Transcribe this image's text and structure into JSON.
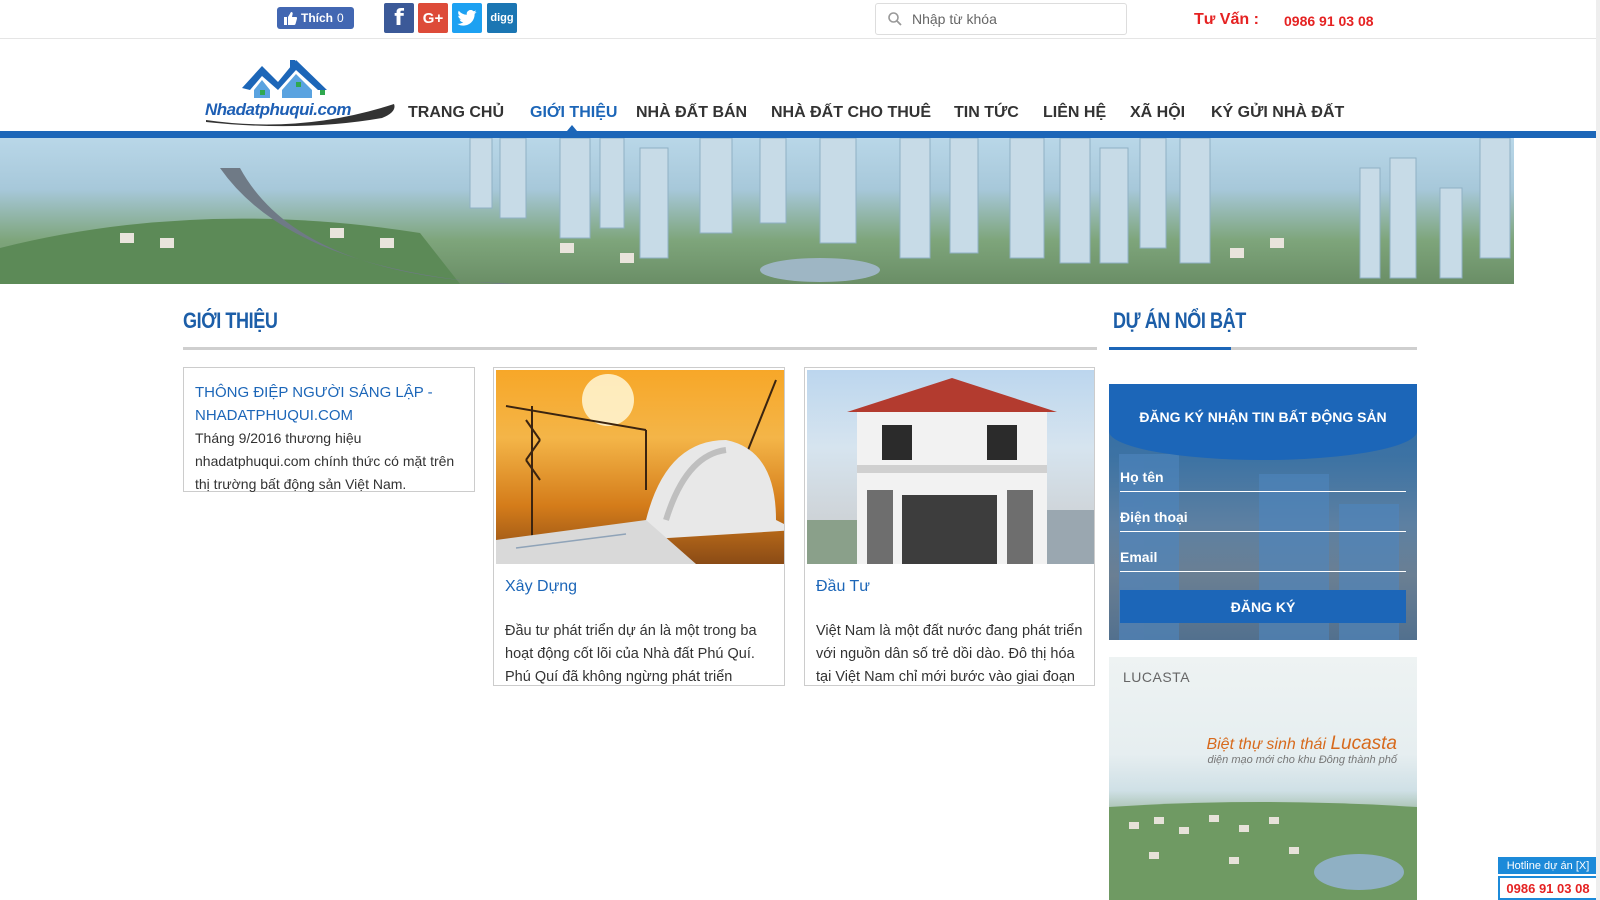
{
  "topbar": {
    "like_label": "Thích",
    "like_count": "0",
    "social": [
      "f",
      "G+",
      "digg"
    ],
    "search_placeholder": "Nhập từ khóa",
    "consult_label": "Tư Vấn :",
    "consult_phone": "0986 91 03 08"
  },
  "header": {
    "logo_text": "Nhadatphuqui.com",
    "nav": [
      "TRANG CHỦ",
      "GIỚI THIỆU",
      "NHÀ ĐẤT BÁN",
      "NHÀ ĐẤT CHO THUÊ",
      "TIN TỨC",
      "LIÊN HỆ",
      "XÃ HỘI",
      "KÝ GỬI NHÀ ĐẤT"
    ],
    "active_nav": "GIỚI THIỆU"
  },
  "main": {
    "title": "GIỚI THIỆU",
    "intro_card": {
      "title": "THÔNG ĐIỆP NGƯỜI SÁNG LẬP - NHADATPHUQUI.COM",
      "text": "Tháng 9/2016 thương hiệu nhadatphuqui.com chính thức có mặt trên thị trường bất động sản Việt Nam."
    },
    "cards": [
      {
        "heading": "Xây Dựng",
        "text": "Đầu tư phát triển dự án là một trong ba hoạt động cốt lõi của Nhà đất Phú Quí. Phú Quí đã không ngừng phát triển"
      },
      {
        "heading": "Đầu Tư",
        "text": "Việt Nam là một đất nước đang phát triển với nguồn dân số trẻ dồi dào. Đô thị hóa tại Việt Nam chỉ mới bước vào giai đoạn"
      }
    ]
  },
  "sidebar": {
    "title": "DỰ ÁN NỔI BẬT",
    "subscribe": {
      "title": "ĐĂNG KÝ NHẬN TIN BẤT ĐỘNG SẢN",
      "name_label": "Họ tên",
      "phone_label": "Điện thoại",
      "email_label": "Email",
      "button": "ĐĂNG KÝ"
    },
    "ad": {
      "brand": "LUCASTA",
      "tagline_prefix": "Biệt thự sinh thái",
      "tagline_name": "Lucasta",
      "subline": "diện mạo mới cho khu Đông thành phố"
    }
  },
  "hotline": {
    "label": "Hotline dự án [X]",
    "phone": "0986 91 03 08"
  },
  "colors": {
    "brand_blue": "#1c66b8",
    "accent_red": "#e52222"
  }
}
